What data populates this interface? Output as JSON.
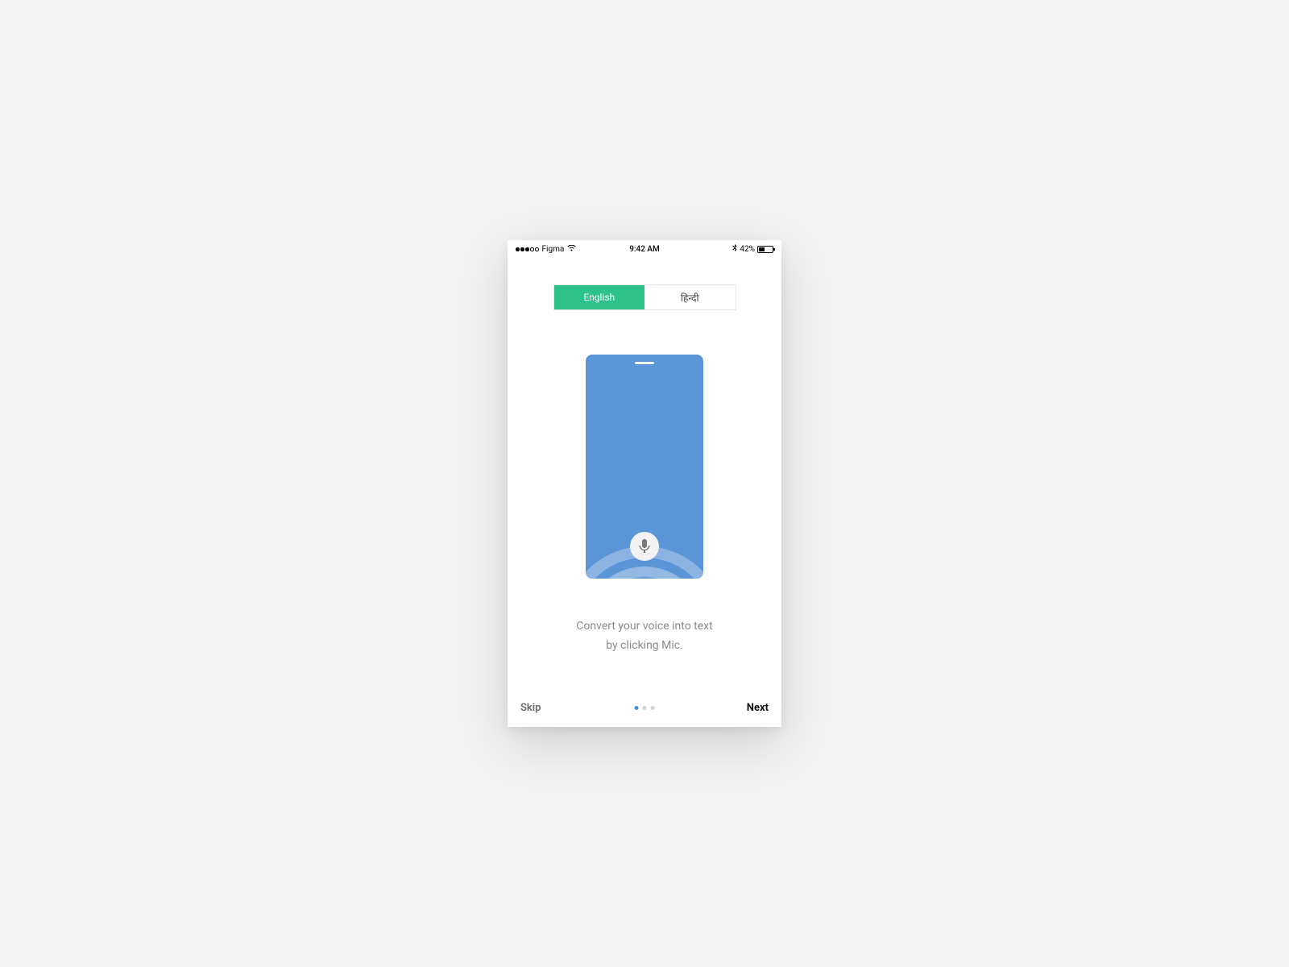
{
  "status_bar": {
    "carrier": "Figma",
    "time": "9:42 AM",
    "battery_pct": "42%"
  },
  "language": {
    "english": "English",
    "hindi": "हिन्दी"
  },
  "caption": {
    "line1": "Convert your voice into text",
    "line2": "by clicking Mic."
  },
  "footer": {
    "skip": "Skip",
    "next": "Next"
  },
  "pager": {
    "total": 3,
    "active_index": 0
  },
  "colors": {
    "accent_green": "#2ec28b",
    "accent_blue": "#5a95d8",
    "pager_active": "#4a90e2"
  }
}
